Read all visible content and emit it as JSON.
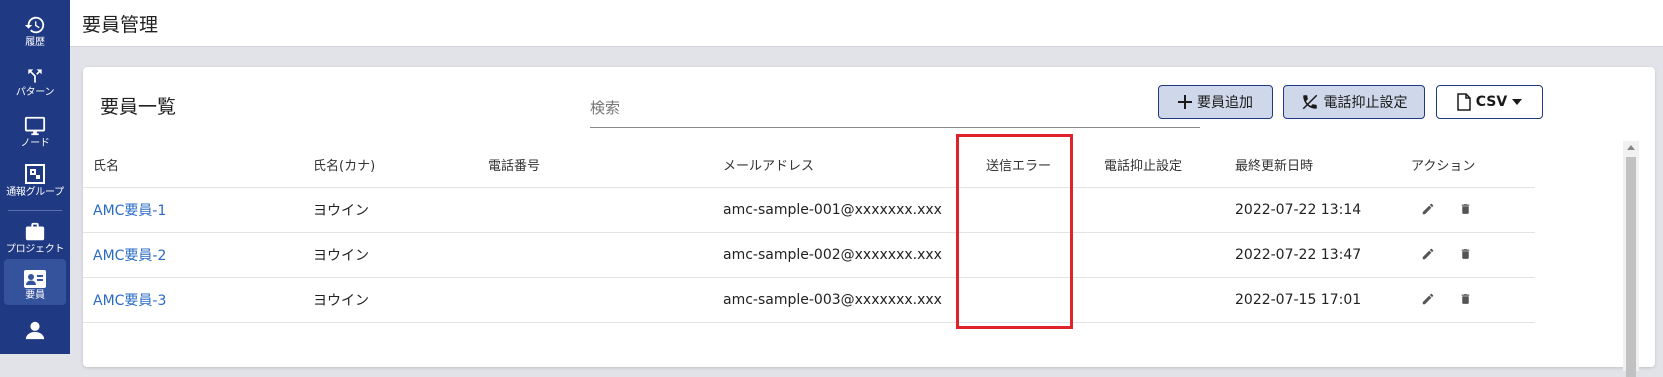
{
  "sidebar": {
    "items": [
      {
        "label": "履歴",
        "icon": "history-icon"
      },
      {
        "label": "パターン",
        "icon": "pattern-icon"
      },
      {
        "label": "ノード",
        "icon": "monitor-icon"
      },
      {
        "label": "通報グループ",
        "icon": "group-icon"
      },
      {
        "label": "プロジェクト",
        "icon": "briefcase-icon"
      },
      {
        "label": "要員",
        "icon": "member-card-icon"
      },
      {
        "label": "",
        "icon": "person-icon"
      }
    ]
  },
  "header": {
    "title": "要員管理"
  },
  "main": {
    "title": "要員一覧",
    "search": {
      "placeholder": "検索",
      "value": ""
    },
    "buttons": {
      "add_member": "要員追加",
      "call_suppress": "電話抑止設定",
      "csv": "CSV"
    },
    "table": {
      "columns": [
        "氏名",
        "氏名(カナ)",
        "電話番号",
        "メールアドレス",
        "送信エラー",
        "電話抑止設定",
        "最終更新日時",
        "アクション"
      ],
      "rows": [
        {
          "name": "AMC要員-1",
          "kana": "ヨウイン",
          "phone": "",
          "email": "amc-sample-001@xxxxxxx.xxx",
          "send_error": "",
          "call_suppress": "",
          "updated": "2022-07-22 13:14"
        },
        {
          "name": "AMC要員-2",
          "kana": "ヨウイン",
          "phone": "",
          "email": "amc-sample-002@xxxxxxx.xxx",
          "send_error": "",
          "call_suppress": "",
          "updated": "2022-07-22 13:47"
        },
        {
          "name": "AMC要員-3",
          "kana": "ヨウイン",
          "phone": "",
          "email": "amc-sample-003@xxxxxxx.xxx",
          "send_error": "",
          "call_suppress": "",
          "updated": "2022-07-15 17:01"
        }
      ]
    }
  },
  "colors": {
    "sidebar": "#1f3a82",
    "link": "#2a6bc4",
    "highlight": "#e0232a",
    "button_fill": "#cfd8ea"
  }
}
